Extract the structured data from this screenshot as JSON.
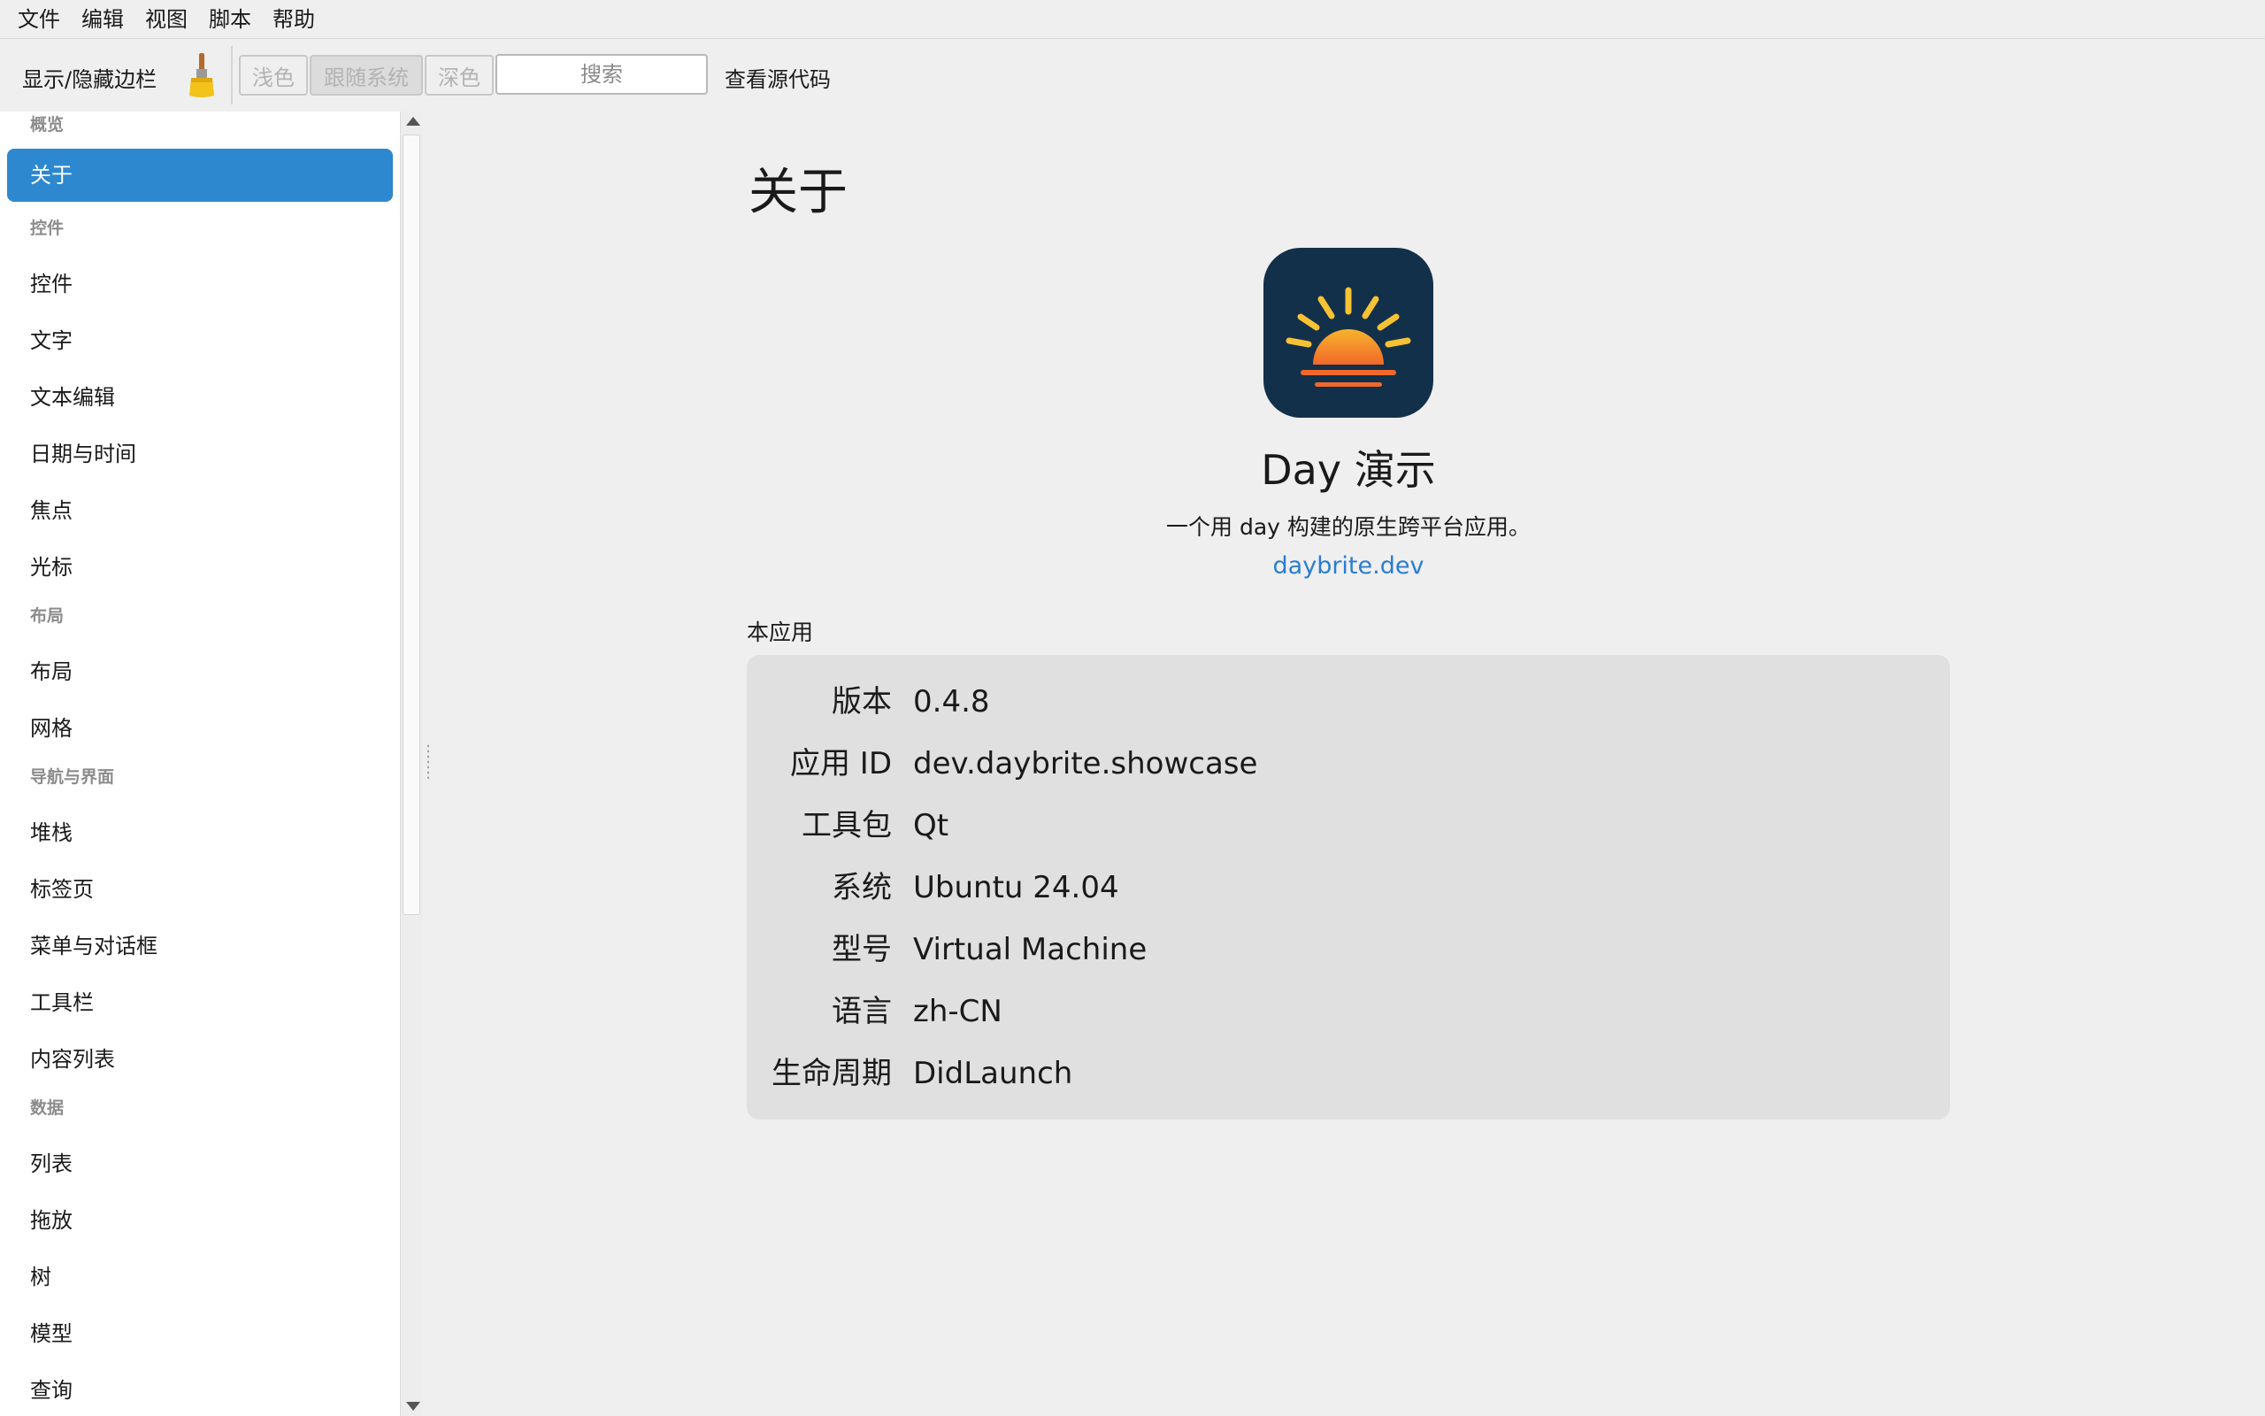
{
  "menubar": {
    "items": [
      {
        "label": "文件"
      },
      {
        "label": "编辑"
      },
      {
        "label": "视图"
      },
      {
        "label": "脚本"
      },
      {
        "label": "帮助"
      }
    ]
  },
  "toolbar": {
    "toggle_sidebar": "显示/隐藏边栏",
    "theme_icon": "paintbrush-icon",
    "theme_light": "浅色",
    "theme_system": "跟随系统",
    "theme_dark": "深色",
    "search_placeholder": "搜索",
    "view_source": "查看源代码"
  },
  "sidebar": {
    "sections": [
      {
        "title": "概览",
        "items": [
          {
            "label": "关于",
            "active": true
          }
        ]
      },
      {
        "title": "控件",
        "items": [
          {
            "label": "控件"
          },
          {
            "label": "文字"
          },
          {
            "label": "文本编辑"
          },
          {
            "label": "日期与时间"
          },
          {
            "label": "焦点"
          },
          {
            "label": "光标"
          }
        ]
      },
      {
        "title": "布局",
        "items": [
          {
            "label": "布局"
          },
          {
            "label": "网格"
          }
        ]
      },
      {
        "title": "导航与界面",
        "items": [
          {
            "label": "堆栈"
          },
          {
            "label": "标签页"
          },
          {
            "label": "菜单与对话框"
          },
          {
            "label": "工具栏"
          },
          {
            "label": "内容列表"
          }
        ]
      },
      {
        "title": "数据",
        "items": [
          {
            "label": "列表"
          },
          {
            "label": "拖放"
          },
          {
            "label": "树"
          },
          {
            "label": "模型"
          },
          {
            "label": "查询"
          }
        ]
      }
    ]
  },
  "main": {
    "title": "关于",
    "app_icon": "sunrise-icon",
    "app_name": "Day 演示",
    "description": "一个用 day 构建的原生跨平台应用。",
    "link": "daybrite.dev",
    "section_label": "本应用",
    "info": [
      {
        "key": "版本",
        "value": "0.4.8"
      },
      {
        "key": "应用 ID",
        "value": "dev.daybrite.showcase"
      },
      {
        "key": "工具包",
        "value": "Qt"
      },
      {
        "key": "系统",
        "value": "Ubuntu 24.04"
      },
      {
        "key": "型号",
        "value": "Virtual Machine"
      },
      {
        "key": "语言",
        "value": "zh-CN"
      },
      {
        "key": "生命周期",
        "value": "DidLaunch"
      }
    ]
  },
  "colors": {
    "accent": "#2d88cf",
    "link": "#2a7dd1",
    "icon_bg": "#13304a",
    "sun_top": "#f7b42c",
    "sun_bottom": "#f2672a"
  }
}
